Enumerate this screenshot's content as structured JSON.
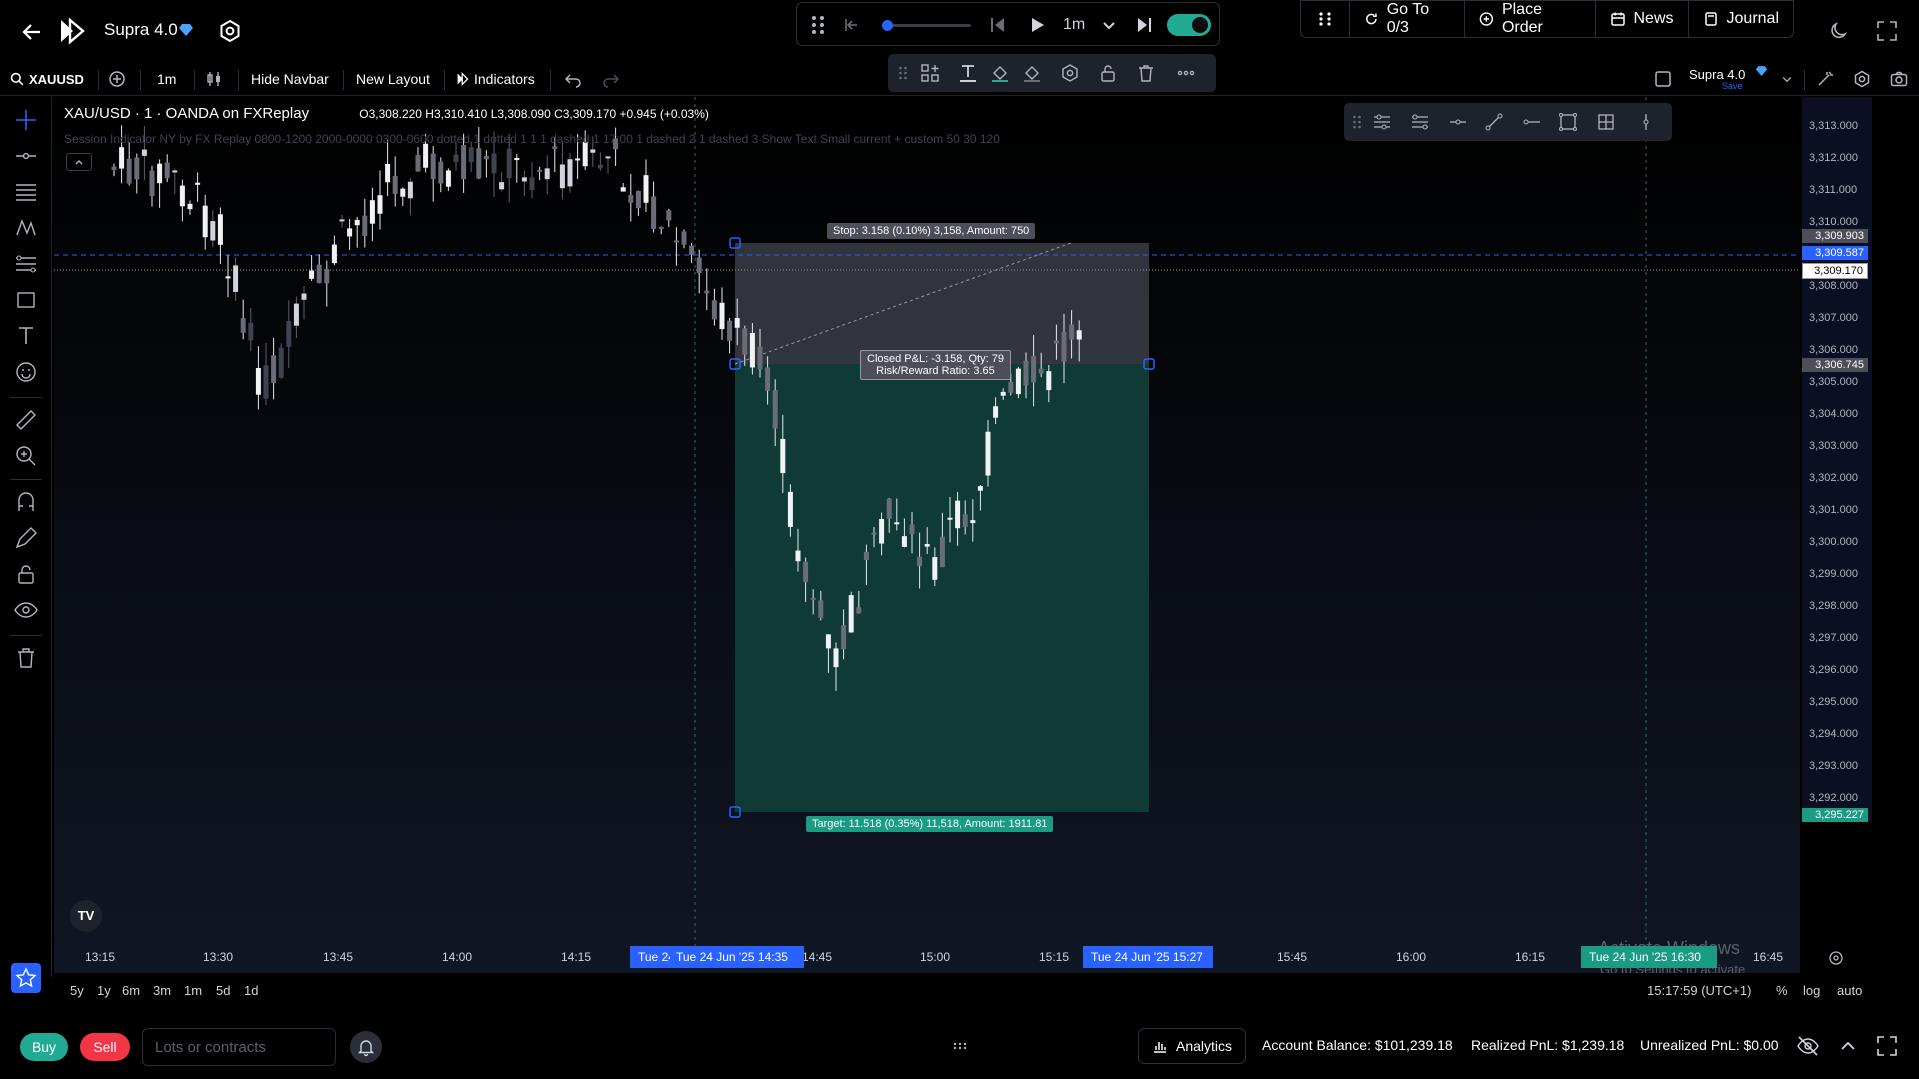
{
  "topbar": {
    "brand": "Supra 4.0",
    "replay_speed": "1m",
    "actions": [
      {
        "label": "Go To 0/3"
      },
      {
        "label": "Place Order"
      },
      {
        "label": "News"
      },
      {
        "label": "Journal"
      }
    ]
  },
  "toolbar": {
    "symbol": "XAUUSD",
    "interval": "1m",
    "hide_navbar": "Hide Navbar",
    "new_layout": "New Layout",
    "indicators": "Indicators",
    "layout_name": "Supra 4.0",
    "layout_save": "Save"
  },
  "chart": {
    "legend_title": "XAU/USD · 1 · OANDA on FXReplay",
    "legend_ohlc": "O3,308.220  H3,310.410  L3,308.090  C3,309.170  +0.945 (+0.03%)",
    "indicator_text": "Session Indicator NY by FX Replay 0800-1200 2000-0000 0300-0600 dotted 1 dotted 1 1 1 dashed 1 17:00 1 dashed 2 1 dashed 3 Show Text Small current + custom 50 30 120",
    "stop_label": "Stop: 3.158 (0.10%) 3,158, Amount: 750",
    "pnl_label_1": "Closed P&L: -3.158, Qty: 79",
    "pnl_label_2": "Risk/Reward Ratio: 3.65",
    "target_label": "Target: 11.518 (0.35%) 11,518, Amount: 1911.81",
    "watermark_1": "Activate Windows",
    "watermark_2": "Go to Settings to activate Windows."
  },
  "price_axis": {
    "ticks": [
      "3,313.000",
      "3,312.000",
      "3,311.000",
      "3,310.000",
      "3,309.000",
      "3,308.000",
      "3,307.000",
      "3,306.000",
      "3,305.000",
      "3,304.000",
      "3,303.000",
      "3,302.000",
      "3,301.000",
      "3,300.000",
      "3,299.000",
      "3,298.000",
      "3,297.000",
      "3,296.000",
      "3,295.000",
      "3,294.000",
      "3,293.000",
      "3,292.000"
    ],
    "badge_stop": "3,309.903",
    "badge_blue": "3,309.587",
    "badge_current": "3,309.170",
    "badge_entry": "3,306.745",
    "badge_target": "3,295.227"
  },
  "time_axis": {
    "labels": [
      "13:15",
      "13:30",
      "13:45",
      "14:00",
      "14:15",
      "14:45",
      "15:00",
      "15:15",
      "15:45",
      "16:00",
      "16:15",
      "16:45"
    ],
    "badge_1a": "Tue 24",
    "badge_1b": "Tue 24 Jun '25   14:35",
    "badge_2": "Tue 24 Jun '25   15:27",
    "badge_3": "Tue 24 Jun '25   16:30"
  },
  "range_bar": {
    "ranges": [
      "5y",
      "1y",
      "6m",
      "3m",
      "1m",
      "5d",
      "1d"
    ],
    "clock": "15:17:59 (UTC+1)",
    "percent": "%",
    "log": "log",
    "auto": "auto"
  },
  "footer": {
    "buy": "Buy",
    "sell": "Sell",
    "lots_placeholder": "Lots or contracts",
    "analytics": "Analytics",
    "balance": "Account Balance: $101,239.18",
    "realized": "Realized PnL: $1,239.18",
    "unrealized": "Unrealized PnL: $0.00"
  },
  "colors": {
    "accent": "#2962ff",
    "bull": "#22ab94",
    "bear": "#f23645",
    "target_zone": "#0f3a35",
    "stop_zone": "#3a3d45"
  }
}
